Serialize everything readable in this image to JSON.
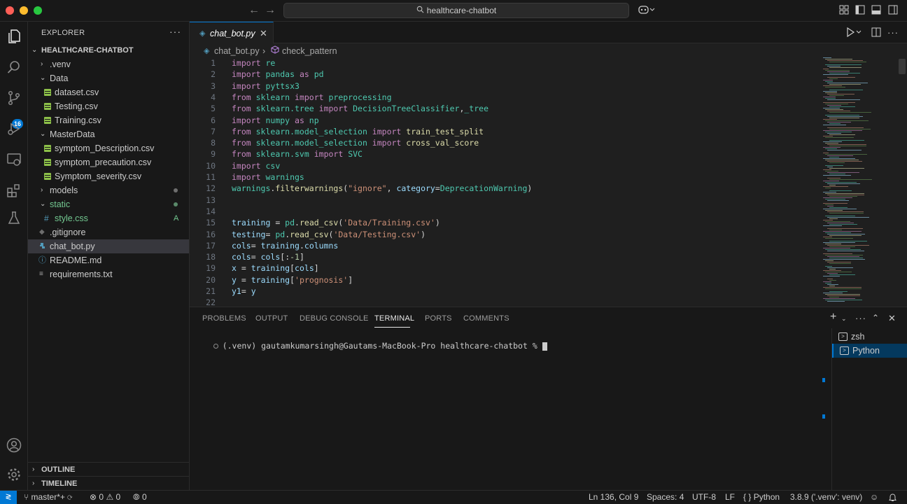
{
  "titlebar": {
    "search_text": "healthcare-chatbot",
    "back_arrow": "←",
    "forward_arrow": "→"
  },
  "activity": {
    "source_control_badge": "16"
  },
  "sidebar": {
    "title": "EXPLORER",
    "more": "···",
    "root": "HEALTHCARE-CHATBOT",
    "items": [
      {
        "label": ".venv",
        "type": "folder",
        "expanded": false
      },
      {
        "label": "Data",
        "type": "folder",
        "expanded": true
      },
      {
        "label": "dataset.csv",
        "type": "csv"
      },
      {
        "label": "Testing.csv",
        "type": "csv"
      },
      {
        "label": "Training.csv",
        "type": "csv"
      },
      {
        "label": "MasterData",
        "type": "folder",
        "expanded": true
      },
      {
        "label": "symptom_Description.csv",
        "type": "csv"
      },
      {
        "label": "symptom_precaution.csv",
        "type": "csv"
      },
      {
        "label": "Symptom_severity.csv",
        "type": "csv"
      },
      {
        "label": "models",
        "type": "folder",
        "expanded": false
      },
      {
        "label": "static",
        "type": "folder",
        "expanded": true
      },
      {
        "label": "style.css",
        "type": "css",
        "git": "A"
      },
      {
        "label": ".gitignore",
        "type": "gitignore"
      },
      {
        "label": "chat_bot.py",
        "type": "python",
        "selected": true
      },
      {
        "label": "README.md",
        "type": "info"
      },
      {
        "label": "requirements.txt",
        "type": "text"
      }
    ],
    "outline": "OUTLINE",
    "timeline": "TIMELINE"
  },
  "editor": {
    "tab_label": "chat_bot.py",
    "breadcrumb": [
      "chat_bot.py",
      "check_pattern"
    ],
    "lines": [
      [
        [
          "kw",
          "import "
        ],
        [
          "id",
          "re"
        ]
      ],
      [
        [
          "kw",
          "import "
        ],
        [
          "id",
          "pandas "
        ],
        [
          "kw",
          "as "
        ],
        [
          "id",
          "pd"
        ]
      ],
      [
        [
          "kw",
          "import "
        ],
        [
          "id",
          "pyttsx3"
        ]
      ],
      [
        [
          "kw",
          "from "
        ],
        [
          "id",
          "sklearn "
        ],
        [
          "kw",
          "import "
        ],
        [
          "id",
          "preprocessing"
        ]
      ],
      [
        [
          "kw",
          "from "
        ],
        [
          "id",
          "sklearn.tree "
        ],
        [
          "kw",
          "import "
        ],
        [
          "id",
          "DecisionTreeClassifier"
        ],
        [
          "pl",
          ","
        ],
        [
          "id",
          "_tree"
        ]
      ],
      [
        [
          "kw",
          "import "
        ],
        [
          "id",
          "numpy "
        ],
        [
          "kw",
          "as "
        ],
        [
          "id",
          "np"
        ]
      ],
      [
        [
          "kw",
          "from "
        ],
        [
          "id",
          "sklearn.model_selection "
        ],
        [
          "kw",
          "import "
        ],
        [
          "fn",
          "train_test_split"
        ]
      ],
      [
        [
          "kw",
          "from "
        ],
        [
          "id",
          "sklearn.model_selection "
        ],
        [
          "kw",
          "import "
        ],
        [
          "fn",
          "cross_val_score"
        ]
      ],
      [
        [
          "kw",
          "from "
        ],
        [
          "id",
          "sklearn.svm "
        ],
        [
          "kw",
          "import "
        ],
        [
          "id",
          "SVC"
        ]
      ],
      [
        [
          "kw",
          "import "
        ],
        [
          "id",
          "csv"
        ]
      ],
      [
        [
          "kw",
          "import "
        ],
        [
          "id",
          "warnings"
        ]
      ],
      [
        [
          "id",
          "warnings"
        ],
        [
          "pl",
          "."
        ],
        [
          "fn",
          "filterwarnings"
        ],
        [
          "pl",
          "("
        ],
        [
          "st",
          "\"ignore\""
        ],
        [
          "pl",
          ", "
        ],
        [
          "tx",
          "category"
        ],
        [
          "pl",
          "="
        ],
        [
          "id",
          "DeprecationWarning"
        ],
        [
          "pl",
          ")"
        ]
      ],
      [],
      [],
      [
        [
          "tx",
          "training "
        ],
        [
          "pl",
          "= "
        ],
        [
          "id",
          "pd"
        ],
        [
          "pl",
          "."
        ],
        [
          "fn",
          "read_csv"
        ],
        [
          "pl",
          "("
        ],
        [
          "st",
          "'Data/Training.csv'"
        ],
        [
          "pl",
          ")"
        ]
      ],
      [
        [
          "tx",
          "testing"
        ],
        [
          "pl",
          "= "
        ],
        [
          "id",
          "pd"
        ],
        [
          "pl",
          "."
        ],
        [
          "fn",
          "read_csv"
        ],
        [
          "pl",
          "("
        ],
        [
          "st",
          "'Data/Testing.csv'"
        ],
        [
          "pl",
          ")"
        ]
      ],
      [
        [
          "tx",
          "cols"
        ],
        [
          "pl",
          "= "
        ],
        [
          "tx",
          "training"
        ],
        [
          "pl",
          "."
        ],
        [
          "tx",
          "columns"
        ]
      ],
      [
        [
          "tx",
          "cols"
        ],
        [
          "pl",
          "= "
        ],
        [
          "tx",
          "cols"
        ],
        [
          "pl",
          "[:"
        ],
        [
          "nm",
          "-1"
        ],
        [
          "pl",
          "]"
        ]
      ],
      [
        [
          "tx",
          "x "
        ],
        [
          "pl",
          "= "
        ],
        [
          "tx",
          "training"
        ],
        [
          "pl",
          "["
        ],
        [
          "tx",
          "cols"
        ],
        [
          "pl",
          "]"
        ]
      ],
      [
        [
          "tx",
          "y "
        ],
        [
          "pl",
          "= "
        ],
        [
          "tx",
          "training"
        ],
        [
          "pl",
          "["
        ],
        [
          "st",
          "'prognosis'"
        ],
        [
          "pl",
          "]"
        ]
      ],
      [
        [
          "tx",
          "y1"
        ],
        [
          "pl",
          "= "
        ],
        [
          "tx",
          "y"
        ]
      ],
      []
    ]
  },
  "panel": {
    "tabs": [
      "PROBLEMS",
      "OUTPUT",
      "DEBUG CONSOLE",
      "TERMINAL",
      "PORTS",
      "COMMENTS"
    ],
    "active_tab": "TERMINAL",
    "prompt": "(.venv) gautamkumarsingh@Gautams-MacBook-Pro healthcare-chatbot % ",
    "terminals": [
      "zsh",
      "Python"
    ],
    "selected_terminal": "Python"
  },
  "statusbar": {
    "branch": "master*+",
    "errors": "0",
    "warnings": "0",
    "ports": "0",
    "position": "Ln 136, Col 9",
    "spaces": "Spaces: 4",
    "encoding": "UTF-8",
    "eol": "LF",
    "language": "Python",
    "interpreter": "3.8.9 ('.venv': venv)"
  },
  "colors": {
    "accent": "#0078d4",
    "background": "#1f1f1f",
    "sidebar": "#181818"
  }
}
